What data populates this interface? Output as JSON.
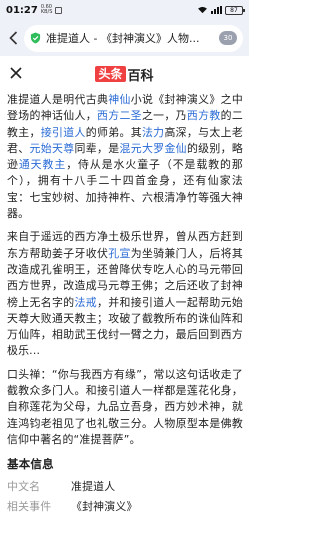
{
  "status": {
    "time": "01:27",
    "speed_value": "0.60",
    "speed_unit": "KB/S",
    "battery": "87"
  },
  "browser": {
    "url_text": "准提道人 - 《封神演义》人物...",
    "tab_count": "30"
  },
  "header": {
    "logo_badge": "头条",
    "logo_text": "百科"
  },
  "article": {
    "p1": [
      {
        "t": "准提道人是明代古典"
      },
      {
        "t": "神仙",
        "link": true
      },
      {
        "t": "小说《封神演义》之中登场的神话仙人，"
      },
      {
        "t": "西方二圣",
        "link": true
      },
      {
        "t": "之一，乃"
      },
      {
        "t": "西方教",
        "link": true
      },
      {
        "t": "的二教主，"
      },
      {
        "t": "接引道人",
        "link": true
      },
      {
        "t": "的师弟。其"
      },
      {
        "t": "法力",
        "link": true
      },
      {
        "t": "高深，与太上老君、"
      },
      {
        "t": "元始天尊",
        "link": true
      },
      {
        "t": "同辈，是"
      },
      {
        "t": "混元大罗金仙",
        "link": true
      },
      {
        "t": "的级别，略逊"
      },
      {
        "t": "通天教主",
        "link": true
      },
      {
        "t": "，侍从是水火童子（不是载教的那个），拥有十八手二十四首金身，还有仙家法宝：七宝妙树、加持神杵、六根清净竹等强大神器。"
      }
    ],
    "p2": [
      {
        "t": "来自于遥远的西方净土极乐世界，曾从西方赶到东方帮助姜子牙收伏"
      },
      {
        "t": "孔宣",
        "link": true
      },
      {
        "t": "为坐骑兼门人，后将其改造成孔雀明王，还曾降伏专吃人心的马元带回西方世界，改造成马元尊王佛；之后还收了封神榜上无名字的"
      },
      {
        "t": "法戒",
        "link": true
      },
      {
        "t": "，并和接引道人一起帮助元始天尊大败通天教主；攻破了截教所布的诛仙阵和万仙阵，相助武王伐纣一臂之力，最后回到西方极乐..."
      }
    ],
    "p3": [
      {
        "t": "口头禅：“你与我西方有缘”，常以这句话收走了截教众多门人。和接引道人一样都是莲花化身，自称莲花为父母，九品立吾身，西方妙术神，就连鸿钧老祖见了也礼敬三分。人物原型本是佛教信仰中著名的“准提菩萨”。"
      }
    ],
    "basic_info_title": "基本信息",
    "info": [
      {
        "key": "中文名",
        "val": "准提道人"
      },
      {
        "key": "相关事件",
        "val": "《封神演义》"
      }
    ]
  }
}
